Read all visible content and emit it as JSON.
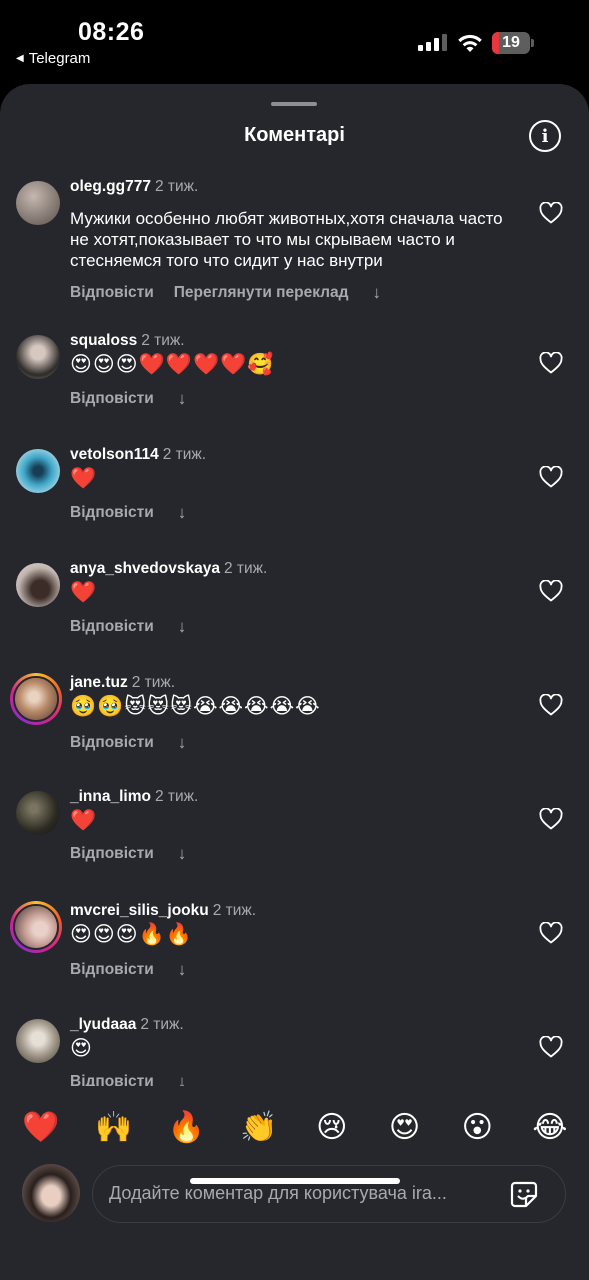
{
  "status_bar": {
    "time": "08:26",
    "back_app": "Telegram",
    "battery": "19",
    "battery_level": 0.19,
    "signal_bars_active": 3
  },
  "sheet": {
    "title": "Коментарі",
    "info_icon": "info-icon"
  },
  "comments": [
    {
      "username": "oleg.gg777",
      "age": "2 тиж.",
      "text": "Мужики особенно любят животных,хотя сначала часто не хотят,показывает то что мы скрываем часто и стесняемся того что сидит у нас внутри",
      "reply": "Відповісти",
      "translate": "Переглянути переклад",
      "avatar_color": "#8a7f79"
    },
    {
      "username": "squaloss",
      "age": "2 тиж.",
      "text": "😍😍😍❤️❤️❤️❤️🥰",
      "reply": "Відповісти",
      "avatar_color": "#6e7a6a"
    },
    {
      "username": "vetolson114",
      "age": "2 тиж.",
      "text": "❤️",
      "reply": "Відповісти",
      "avatar_color": "#3fa7c8"
    },
    {
      "username": "anya_shvedovskaya",
      "age": "2 тиж.",
      "text": "❤️",
      "reply": "Відповісти",
      "avatar_color": "#c9bdb6"
    },
    {
      "username": "jane.tuz",
      "age": "2 тиж.",
      "text": "🥹🥹😻😻😻😭😭😭😭😭",
      "reply": "Відповісти",
      "avatar_color": "#b98a6a"
    },
    {
      "username": "_inna_limo",
      "age": "2 тиж.",
      "text": "❤️",
      "reply": "Відповісти",
      "avatar_color": "#4e4a3c"
    },
    {
      "username": "mvcrei_silis_jooku",
      "age": "2 тиж.",
      "text": "😍😍😍🔥🔥",
      "reply": "Відповісти",
      "avatar_color": "#c69f96"
    },
    {
      "username": "_lyudaaa",
      "age": "2 тиж.",
      "text": "😍",
      "reply": "Відповісти",
      "avatar_color": "#a59c8e"
    }
  ],
  "reactions": [
    "❤️",
    "🙌",
    "🔥",
    "👏",
    "😢",
    "😍",
    "😮",
    "😂"
  ],
  "composer": {
    "placeholder": "Додайте коментар для користувача ira..."
  },
  "colors": {
    "sheet_bg": "#25272c",
    "secondary_text": "#a8a9ad",
    "battery_red": "#e8373c"
  }
}
